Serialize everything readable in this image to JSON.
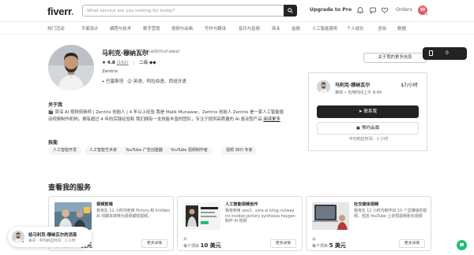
{
  "header": {
    "logo_text": "fiverr",
    "logo_dot": ".",
    "search_placeholder": "What service are you looking for today?",
    "upgrade_label": "Upgrade to Pro",
    "orders_label": "Orders",
    "avatar_initial": "W"
  },
  "categories": [
    "热门活动",
    "平面设计",
    "编程与技术",
    "数字营销",
    "视频与动画",
    "写作与翻译",
    "音乐与音频",
    "商业",
    "金融",
    "人工智能服务",
    "个人成长",
    "咨询",
    "数据"
  ],
  "profile": {
    "name": "马利克·穆纳瓦尔",
    "username": "@malikmunawar",
    "rating": "4.8",
    "reviews": "(162)",
    "level": "二级 ◆◆",
    "company": "Zentrix",
    "location": "巴基斯坦",
    "languages": "英语、阿拉伯语、西班牙语",
    "more_about_button": "关于我的更多信息"
  },
  "about": {
    "title": "关于我",
    "text": "🎬 资深 AI 视频剪辑师 | Zentrix 创始人 | 4 年以上经验 我是 Malik Munawar，Zentrix 创始人 Zentrix 是一家人工智能驱动视频制作机构，拥有超过 4 年的实践经验和 我们拥有一支技能丰富的团队，专注于提供高质量的 AI 驱动型产品",
    "read_more": "阅读更多"
  },
  "skills": {
    "title": "技能",
    "items": [
      "人工智能开发",
      "人工智能艺术家",
      "YouTube 广告创建器",
      "YouTube 视频制作者",
      "视频 SEO 专家"
    ]
  },
  "contact_card": {
    "name": "马利克·穆纳瓦尔",
    "rate": "$7/小时",
    "status": "离线 • 当地时间上午 8:49",
    "contact_button": "联系我",
    "meeting_button": "预约会面",
    "response_time": "平均响应时间：1 小时"
  },
  "saved_toggle": {
    "count": "0"
  },
  "services": {
    "title": "查看我的服务",
    "cards": [
      {
        "category": "视频剪辑",
        "description": "我将在 12 小时内使用 Pictory 和 InVideo AI 将脚本转换为视频或短视频。",
        "from_label": "从",
        "price_prefix": "每个项目",
        "price": "10 美元",
        "more_button": "更多详情"
      },
      {
        "category": "人工智能视频创作",
        "description": "我将使用 veo3、sora ai kling runway ml invideo pictory synthesia heygen 制作 AI 视频",
        "from_label": "从",
        "price_prefix": "每个项目",
        "price": "10 美元",
        "more_button": "更多详情"
      },
      {
        "category": "社交媒体视频",
        "description": "我将在 12 小时内制作出 10 个显赚钱的视频，包括 YouTube 上的短视频和长视频",
        "from_label": "从",
        "price_prefix": "每个项目",
        "price": "5 美元",
        "more_button": "更多详情"
      }
    ]
  },
  "chat": {
    "title": "给马利克·穆纳瓦尔的消息",
    "subtitle": "离开 · 平均响应时间：1 小时"
  },
  "colors": {
    "brand_green": "#1dbf73",
    "dark": "#222325",
    "avatar_red": "#e05c6a"
  }
}
